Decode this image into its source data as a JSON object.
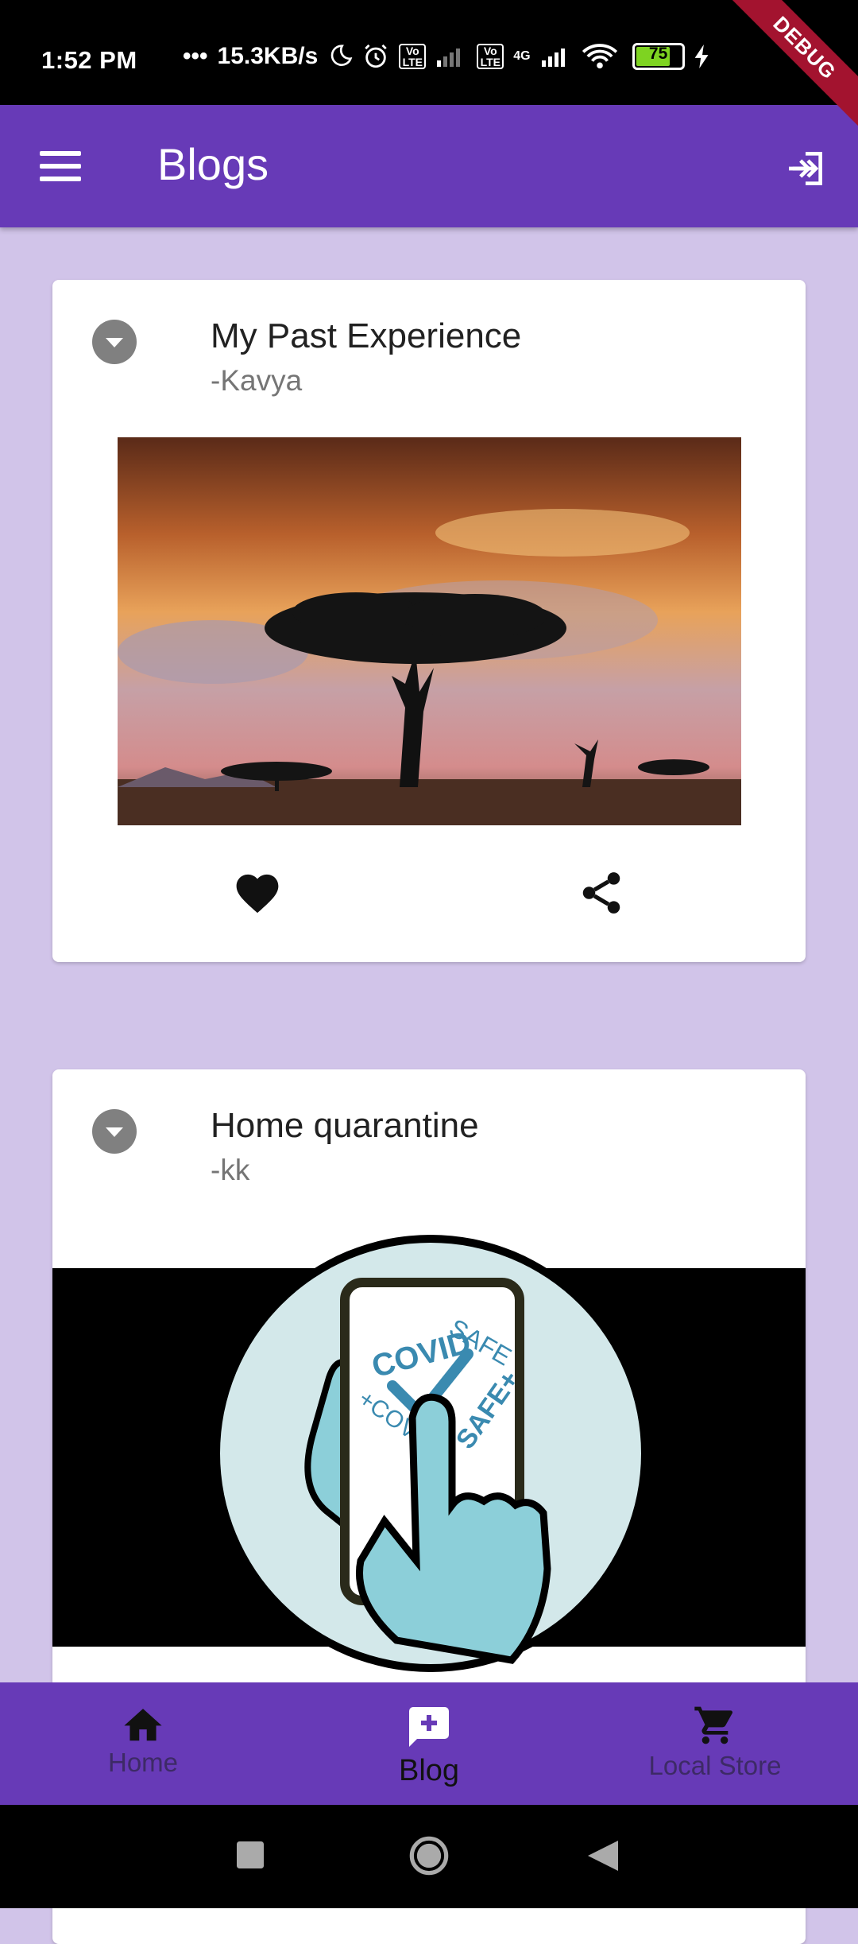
{
  "status_bar": {
    "time": "1:52 PM",
    "dots": "•••",
    "speed": "15.3KB/s",
    "volte": "Vo LTE",
    "network": "4G",
    "battery": "75"
  },
  "debug_banner": "DEBUG",
  "app_bar": {
    "title": "Blogs",
    "menu_icon": "menu-icon",
    "logout_icon": "logout-icon"
  },
  "posts": [
    {
      "title": "My Past Experience",
      "author": "-Kavya"
    },
    {
      "title": "Home quarantine",
      "author": "-kk"
    }
  ],
  "covid_image": {
    "word1": "COVID",
    "word2": "SAFE",
    "word3": "+COV",
    "word4": "SAFE+"
  },
  "bottom_nav": [
    {
      "label": "Home",
      "icon": "home-icon"
    },
    {
      "label": "Blog",
      "icon": "add-comment-icon",
      "active": true
    },
    {
      "label": "Local Store",
      "icon": "cart-icon"
    }
  ],
  "colors": {
    "primary": "#673ab7",
    "background": "#d1c4e9"
  }
}
